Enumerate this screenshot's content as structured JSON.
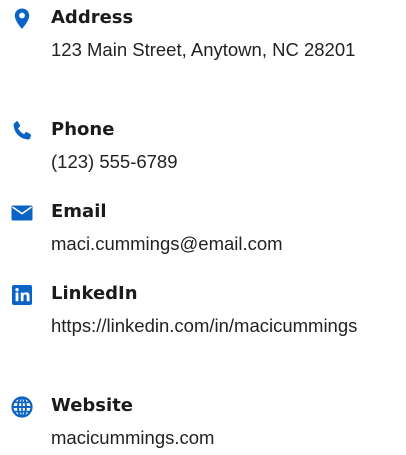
{
  "accent_color": "#0c63c6",
  "items": [
    {
      "icon": "map-pin-icon",
      "label": "Address",
      "value": "123 Main Street, Anytown, NC 28201"
    },
    {
      "icon": "phone-icon",
      "label": "Phone",
      "value": "(123) 555-6789"
    },
    {
      "icon": "envelope-icon",
      "label": "Email",
      "value": "maci.cummings@email.com"
    },
    {
      "icon": "linkedin-icon",
      "label": "LinkedIn",
      "value": "https://linkedin.com/in/macicummings"
    },
    {
      "icon": "globe-icon",
      "label": "Website",
      "value": "macicummings.com"
    }
  ]
}
